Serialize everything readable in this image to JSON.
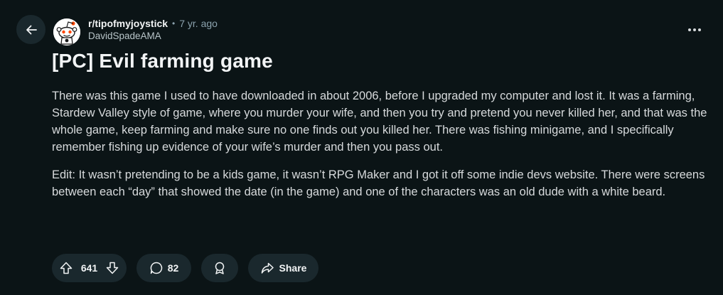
{
  "post": {
    "subreddit": "r/tipofmyjoystick",
    "separator": "•",
    "age": "7 yr. ago",
    "author": "DavidSpadeAMA",
    "title": "[PC] Evil farming game",
    "paragraphs": [
      "There was this game I used to have downloaded in about 2006, before I upgraded my computer and lost it. It was a farming, Stardew Valley style of game, where you murder your wife, and then you try and pretend you never killed her, and that was the whole game, keep farming and make sure no one finds out you killed her. There was fishing minigame, and I specifically remember fishing up evidence of your wife’s murder and then you pass out.",
      "Edit: It wasn’t pretending to be a kids game, it wasn’t RPG Maker and I got it off some indie devs website. There were screens between each “day” that showed the date (in the game) and one of the characters was an old dude with a white beard."
    ]
  },
  "actions": {
    "upvotes": "641",
    "comments": "82",
    "share_label": "Share"
  },
  "icons": {
    "back": "arrow-left-icon",
    "avatar": "snoo-avatar-icon",
    "more": "more-horizontal-icon",
    "upvote": "upvote-arrow-icon",
    "downvote": "downvote-arrow-icon",
    "comment": "comment-bubble-icon",
    "award": "award-ribbon-icon",
    "share": "share-arrow-icon"
  },
  "colors": {
    "background": "#0b1416",
    "pill": "#1a282d",
    "text": "#d7dadc",
    "muted": "#8ba2ad"
  }
}
